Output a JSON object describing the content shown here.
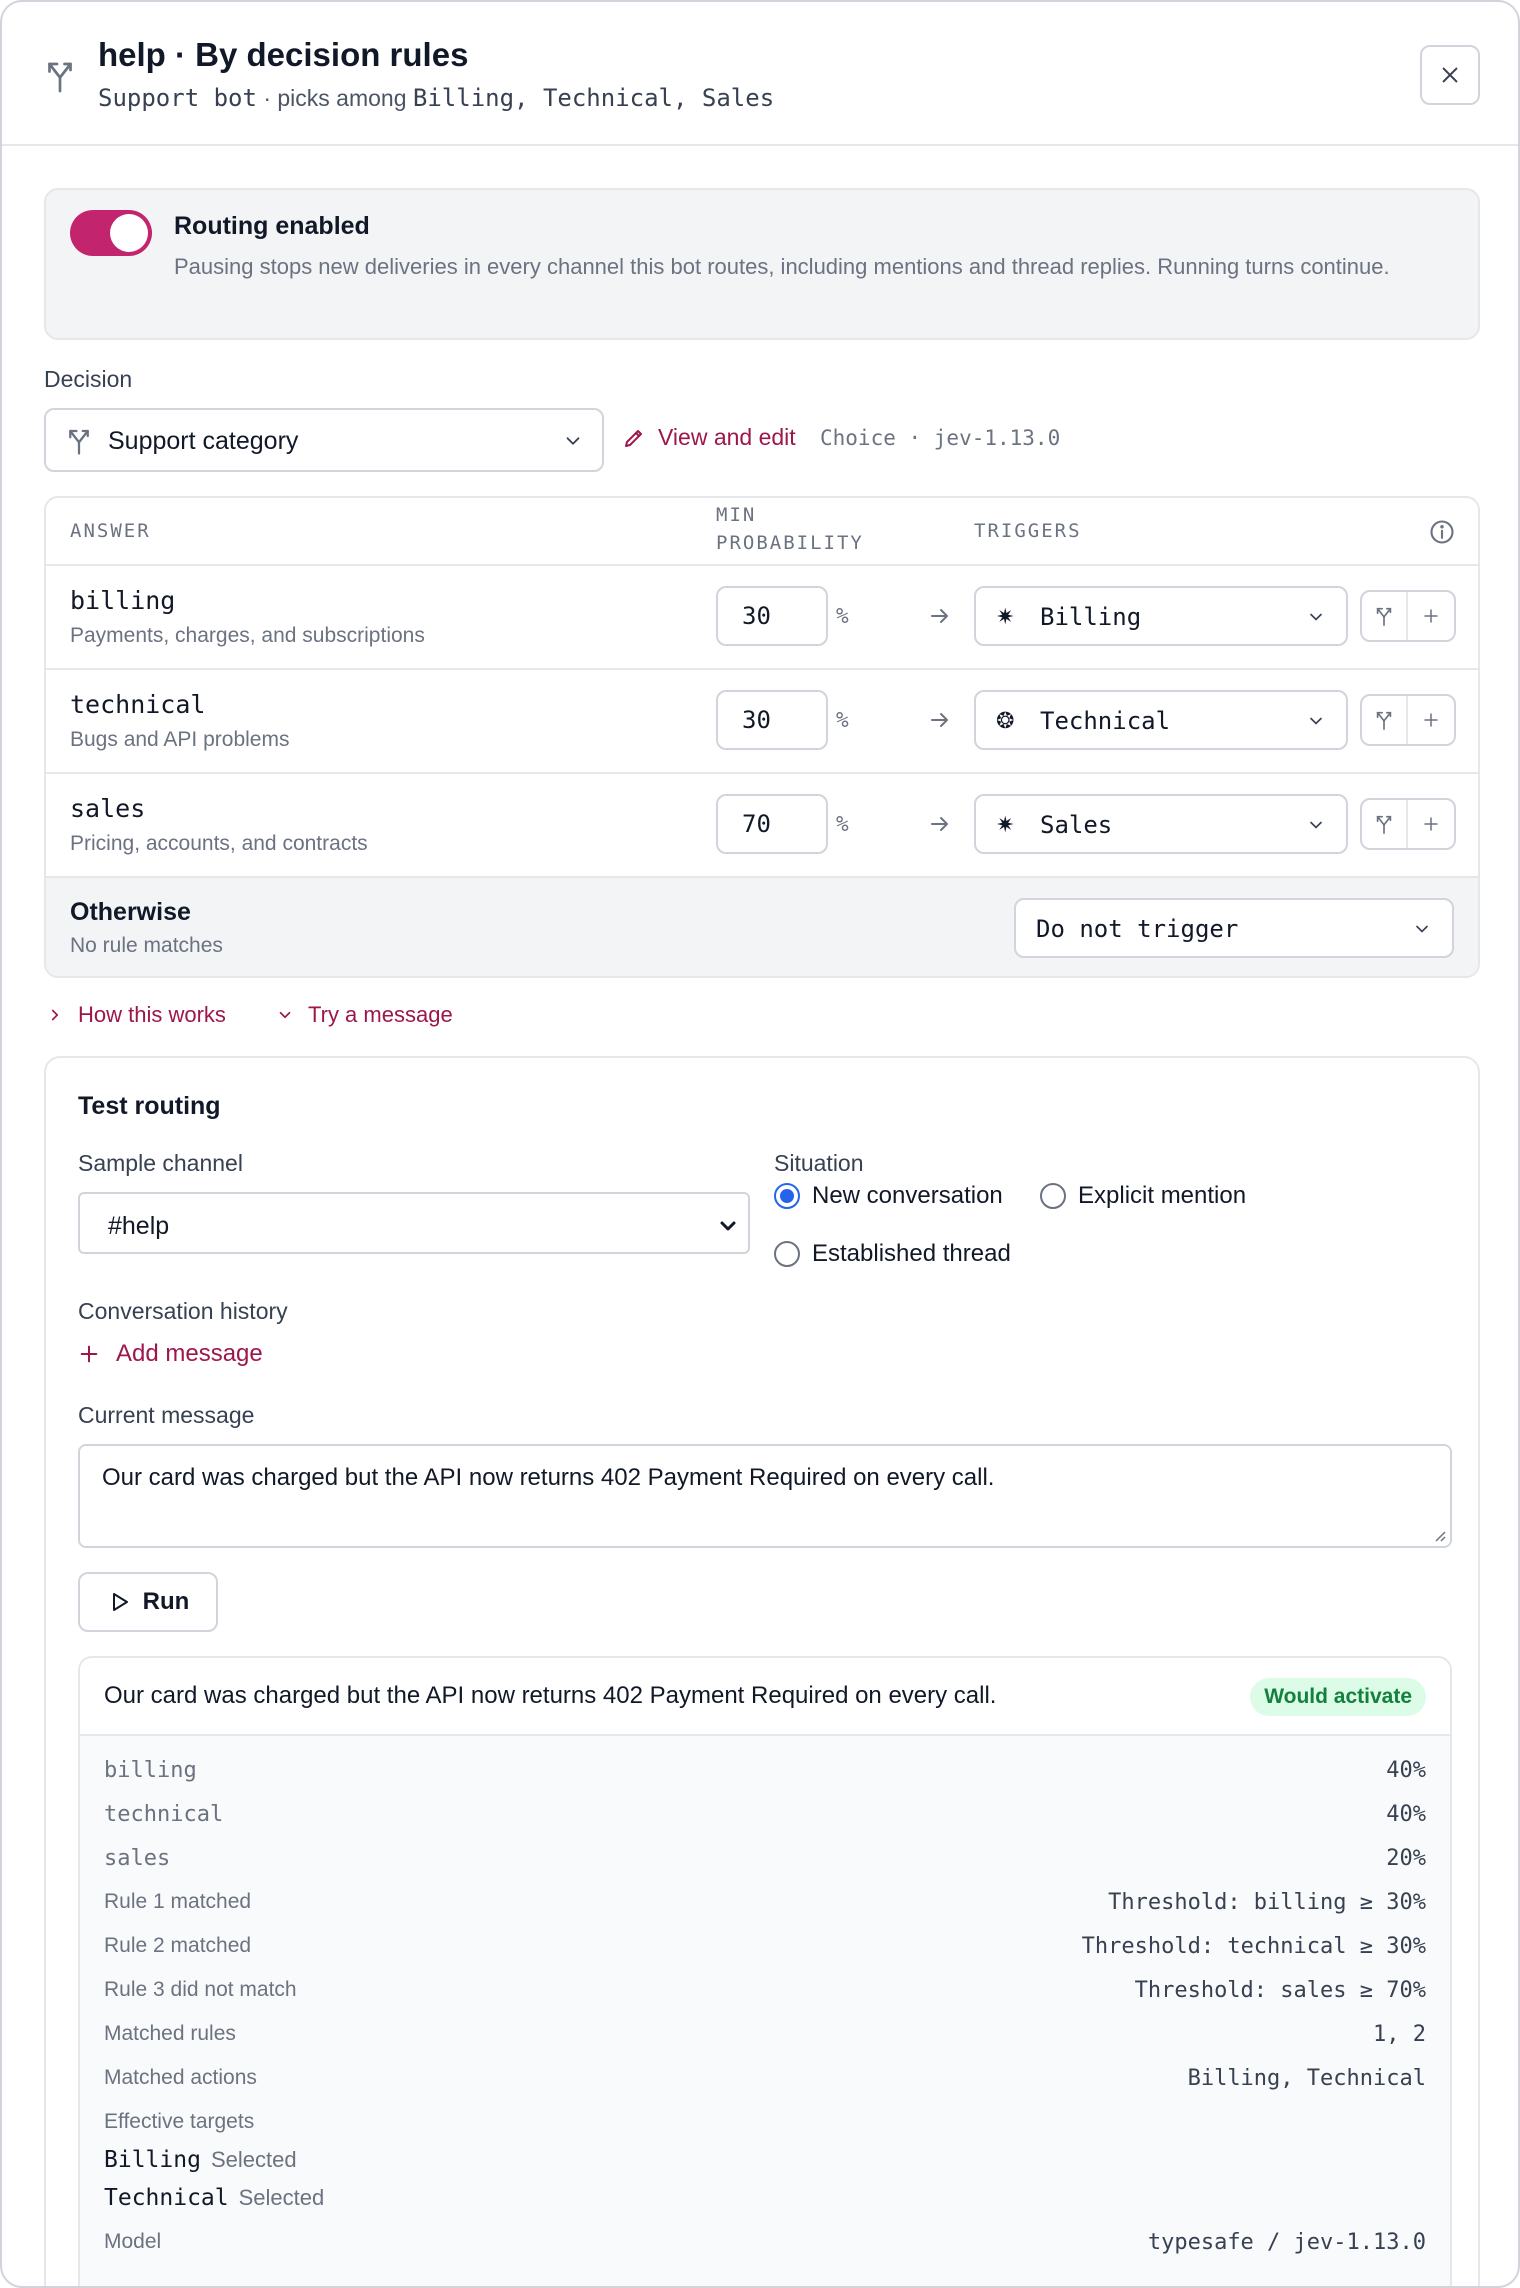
{
  "header": {
    "title": "help · By decision rules",
    "bot_name": "Support bot",
    "picks_text": "· picks among",
    "picks_list": "Billing, Technical, Sales"
  },
  "routing": {
    "enabled": true,
    "title": "Routing enabled",
    "description": "Pausing stops new deliveries in every channel this bot routes, including mentions and thread replies. Running turns continue."
  },
  "decision": {
    "label": "Decision",
    "selected": "Support category",
    "view_edit": "View and edit",
    "meta": "Choice · jev-1.13.0"
  },
  "rules": {
    "headers": {
      "answer": "ANSWER",
      "min_prob_1": "MIN",
      "min_prob_2": "PROBABILITY",
      "triggers": "TRIGGERS"
    },
    "rows": [
      {
        "name": "billing",
        "desc": "Payments, charges, and subscriptions",
        "min": "30",
        "unit": "%",
        "trigger": "Billing",
        "trigger_icon": "✷"
      },
      {
        "name": "technical",
        "desc": "Bugs and API problems",
        "min": "30",
        "unit": "%",
        "trigger": "Technical",
        "trigger_icon": "❂"
      },
      {
        "name": "sales",
        "desc": "Pricing, accounts, and contracts",
        "min": "70",
        "unit": "%",
        "trigger": "Sales",
        "trigger_icon": "✷"
      }
    ],
    "otherwise": {
      "title": "Otherwise",
      "subtitle": "No rule matches",
      "action": "Do not trigger"
    }
  },
  "links": {
    "how": "How this works",
    "try": "Try a message"
  },
  "test": {
    "title": "Test routing",
    "channel_label": "Sample channel",
    "channel_value": "#help",
    "situation_label": "Situation",
    "situations": [
      {
        "label": "New conversation",
        "selected": true
      },
      {
        "label": "Explicit mention",
        "selected": false
      },
      {
        "label": "Established thread",
        "selected": false
      }
    ],
    "history_label": "Conversation history",
    "add_message": "Add message",
    "current_label": "Current message",
    "current_value": "Our card was charged but the API now returns 402 Payment Required on every call.",
    "run": "Run"
  },
  "result": {
    "message": "Our card was charged but the API now returns 402 Payment Required on every call.",
    "badge": "Would activate",
    "scores": [
      {
        "label": "billing",
        "value": "40%"
      },
      {
        "label": "technical",
        "value": "40%"
      },
      {
        "label": "sales",
        "value": "20%"
      }
    ],
    "rules": [
      {
        "label": "Rule 1 matched",
        "value": "Threshold: billing ≥ 30%"
      },
      {
        "label": "Rule 2 matched",
        "value": "Threshold: technical ≥ 30%"
      },
      {
        "label": "Rule 3 did not match",
        "value": "Threshold: sales ≥ 70%"
      },
      {
        "label": "Matched rules",
        "value": "1, 2"
      },
      {
        "label": "Matched actions",
        "value": "Billing, Technical"
      }
    ],
    "effective_label": "Effective targets",
    "effective": [
      {
        "name": "Billing",
        "status": "Selected"
      },
      {
        "name": "Technical",
        "status": "Selected"
      }
    ],
    "model_label": "Model",
    "model_value": "typesafe / jev-1.13.0"
  },
  "colors": {
    "accent": "#c2256e",
    "link": "#9d174d",
    "success_bg": "#dcfce7",
    "success_text": "#15803d",
    "radio": "#2563eb"
  }
}
